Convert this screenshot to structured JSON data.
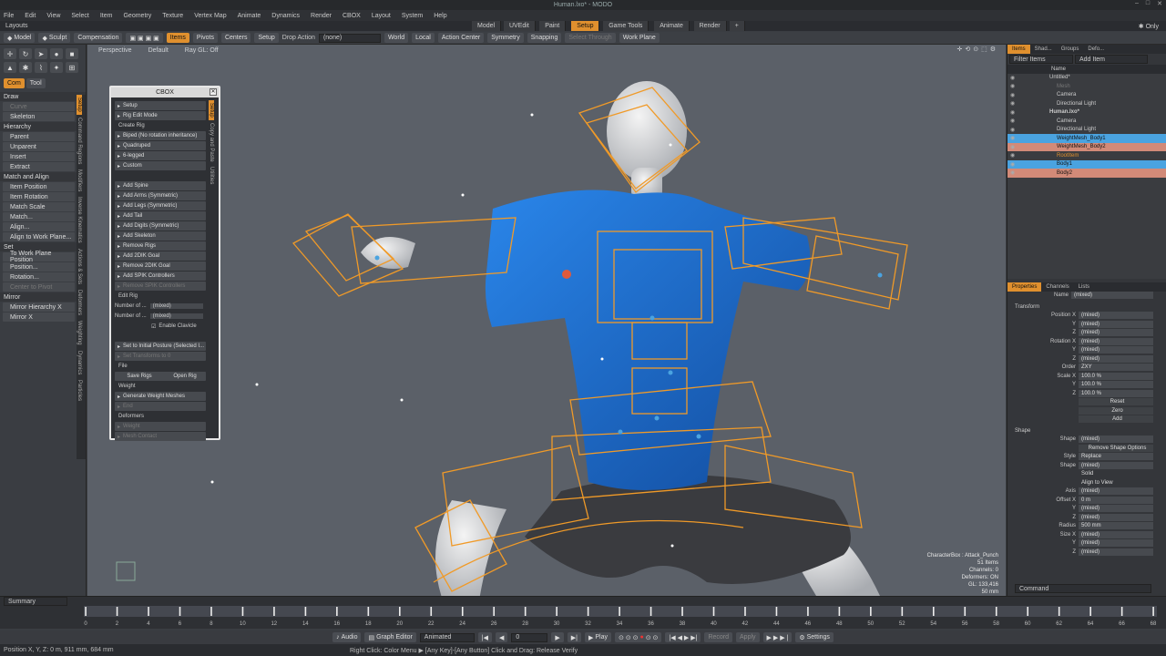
{
  "title": "Human.lxo* - MODO",
  "menu": [
    "File",
    "Edit",
    "View",
    "Select",
    "Item",
    "Geometry",
    "Texture",
    "Vertex Map",
    "Animate",
    "Dynamics",
    "Render",
    "CBOX",
    "Layout",
    "System",
    "Help"
  ],
  "layouts_label": "Layouts",
  "layout_tabs": [
    "Model",
    "UVEdit",
    "Paint",
    "Setup",
    "Game Tools",
    "Animate",
    "Render",
    "+"
  ],
  "layout_active": "Setup",
  "only_label": "Only",
  "toolbar": {
    "model": "Model",
    "sculpt": "Sculpt",
    "compensation": "Compensation",
    "items": "Items",
    "pivots": "Pivots",
    "centers": "Centers",
    "setup": "Setup",
    "drop_action_label": "Drop Action",
    "drop_action_value": "(none)",
    "world": "World",
    "local": "Local",
    "action_center": "Action Center",
    "symmetry": "Symmetry",
    "snapping": "Snapping",
    "select_through": "Select Through",
    "work_plane": "Work Plane"
  },
  "viewport": {
    "projection": "Perspective",
    "shading": "Default",
    "raygl": "Ray GL: Off",
    "info": [
      "CharacterBox : Attack_Punch",
      "51 Items",
      "Channels: 0",
      "Deformers: ON",
      "GL: 133,416",
      "50 mm"
    ]
  },
  "left": {
    "tabs": [
      "Com",
      "Tool"
    ],
    "items": [
      [
        "h",
        "Draw"
      ],
      [
        "d",
        "Curve"
      ],
      [
        "b",
        "Skeleton"
      ],
      [
        "h",
        "Hierarchy"
      ],
      [
        "b",
        "Parent"
      ],
      [
        "b",
        "Unparent"
      ],
      [
        "b",
        "Insert"
      ],
      [
        "b",
        "Extract"
      ],
      [
        "h",
        "Match and Align"
      ],
      [
        "b",
        "Item Position"
      ],
      [
        "b",
        "Item Rotation"
      ],
      [
        "b",
        "Match Scale"
      ],
      [
        "b",
        "Match..."
      ],
      [
        "b",
        "Align..."
      ],
      [
        "b",
        "Align to Work Plane..."
      ],
      [
        "h",
        "Set"
      ],
      [
        "b",
        "To Work Plane Position"
      ],
      [
        "b",
        "Position..."
      ],
      [
        "b",
        "Rotation..."
      ],
      [
        "d",
        "Center to Pivot"
      ],
      [
        "h",
        "Mirror"
      ],
      [
        "b",
        "Mirror Hierarchy X"
      ],
      [
        "b",
        "Mirror X"
      ]
    ],
    "vtabs": [
      "Setup",
      "Command Regions",
      "Modifiers",
      "Inverse Kinematics",
      "Actions & Sets",
      "Deformers",
      "Weighting",
      "Dynamics",
      "Particles"
    ]
  },
  "cbox": {
    "title": "CBOX",
    "rows": [
      [
        "b",
        "Setup"
      ],
      [
        "b",
        "Rig Edit Mode"
      ],
      [
        "s",
        "Create Rig"
      ],
      [
        "b",
        "Biped (No rotation inheritance)"
      ],
      [
        "b",
        "Quadruped"
      ],
      [
        "b",
        "6-legged"
      ],
      [
        "b",
        "Custom"
      ],
      [
        "s",
        ""
      ],
      [
        "b",
        "Add Spine"
      ],
      [
        "b",
        "Add Arms (Symmetric)"
      ],
      [
        "b",
        "Add Legs (Symmetric)"
      ],
      [
        "b",
        "Add Tail"
      ],
      [
        "b",
        "Add Digits (Symmetric)"
      ],
      [
        "b",
        "Add Skeleton"
      ],
      [
        "b",
        "Remove Rigs"
      ],
      [
        "b",
        "Add 2DIK Goal"
      ],
      [
        "b",
        "Remove 2DIK Goal"
      ],
      [
        "b",
        "Add SPIK Controllers"
      ],
      [
        "d",
        "Remove SPIK Controllers"
      ],
      [
        "s",
        "Edit Rig"
      ],
      [
        "f",
        "Number of ...",
        "(mixed)"
      ],
      [
        "f",
        "Number of ...",
        "(mixed)"
      ],
      [
        "c",
        "Enable Clavicle"
      ],
      [
        "s",
        ""
      ],
      [
        "b",
        "Set to Initial Posture (Selected I..."
      ],
      [
        "d",
        "Set Transforms to 0"
      ],
      [
        "s",
        "File"
      ],
      [
        "b2",
        "Save Rigs",
        "Open Rig"
      ],
      [
        "s",
        "Weight"
      ],
      [
        "b",
        "Generate Weight Meshes"
      ],
      [
        "d",
        "End"
      ],
      [
        "s",
        "Deformers"
      ],
      [
        "d",
        "Weight"
      ],
      [
        "d",
        "Mesh Contact"
      ]
    ],
    "vtabs": [
      "Setup",
      "Copy and Paste",
      "Utilities"
    ]
  },
  "items_panel": {
    "tabs": [
      "Items",
      "Shad...",
      "Groups",
      "Defo..."
    ],
    "filter": "Filter Items",
    "add_item": "Add Item",
    "name_col": "Name",
    "rows": [
      [
        "n",
        1,
        "Untitled*"
      ],
      [
        "d",
        2,
        "Mesh"
      ],
      [
        "n",
        2,
        "Camera"
      ],
      [
        "n",
        2,
        "Directional Light"
      ],
      [
        "b",
        1,
        "Human.lxo*"
      ],
      [
        "n",
        2,
        "Camera"
      ],
      [
        "n",
        2,
        "Directional Light"
      ],
      [
        "s",
        2,
        "WeightMesh_Body1"
      ],
      [
        "h",
        2,
        "WeightMesh_Body2"
      ],
      [
        "o",
        2,
        "RootItem"
      ],
      [
        "s",
        2,
        "Body1"
      ],
      [
        "h",
        2,
        "Body2"
      ]
    ]
  },
  "props": {
    "tabs": [
      "Properties",
      "Channels",
      "Lists"
    ],
    "name_label": "Name",
    "name_value": "(mixed)",
    "rows": [
      [
        "s",
        "Transform"
      ],
      [
        "p",
        "Position X",
        "(mixed)"
      ],
      [
        "p",
        "Y",
        "(mixed)"
      ],
      [
        "p",
        "Z",
        "(mixed)"
      ],
      [
        "p",
        "Rotation X",
        "(mixed)"
      ],
      [
        "p",
        "Y",
        "(mixed)"
      ],
      [
        "p",
        "Z",
        "(mixed)"
      ],
      [
        "p",
        "Order",
        "ZXY"
      ],
      [
        "p",
        "Scale X",
        "100.0 %"
      ],
      [
        "p",
        "Y",
        "100.0 %"
      ],
      [
        "p",
        "Z",
        "100.0 %"
      ],
      [
        "b",
        "",
        "Reset"
      ],
      [
        "b",
        "",
        "Zero"
      ],
      [
        "b",
        "",
        "Add"
      ],
      [
        "s",
        "Shape"
      ],
      [
        "p",
        "Shape",
        "(mixed)"
      ],
      [
        "b",
        "",
        "Remove Shape Options"
      ],
      [
        "p",
        "Style",
        "Replace"
      ],
      [
        "p",
        "Shape",
        "(mixed)"
      ],
      [
        "c",
        "",
        "Solid"
      ],
      [
        "c",
        "",
        "Align to View"
      ],
      [
        "p",
        "Axis",
        "(mixed)"
      ],
      [
        "p",
        "Offset X",
        "0 m"
      ],
      [
        "p",
        "Y",
        "(mixed)"
      ],
      [
        "p",
        "Z",
        "(mixed)"
      ],
      [
        "p",
        "Radius",
        "500 mm"
      ],
      [
        "p",
        "Size X",
        "(mixed)"
      ],
      [
        "p",
        "Y",
        "(mixed)"
      ],
      [
        "p",
        "Z",
        "(mixed)"
      ]
    ],
    "command_placeholder": "Command"
  },
  "timeline": {
    "summary": "Summary",
    "ticks": [
      "0",
      "2",
      "4",
      "6",
      "8",
      "10",
      "12",
      "14",
      "16",
      "18",
      "20",
      "22",
      "24",
      "26",
      "28",
      "30",
      "32",
      "34",
      "36",
      "38",
      "40",
      "42",
      "44",
      "46",
      "48",
      "50",
      "52",
      "54",
      "56",
      "58",
      "60",
      "62",
      "64",
      "66",
      "68"
    ]
  },
  "transport": {
    "audio": "Audio",
    "graph_editor": "Graph Editor",
    "animated": "Animated",
    "frame": "0",
    "play": "Play",
    "record": "Record",
    "apply": "Apply",
    "settings": "Settings"
  },
  "status": {
    "left": "Position X, Y, Z:  0 m, 911 mm, 684 mm",
    "center": "Right Click: Color Menu  ▶ [Any Key]-[Any Button] Click and Drag: Release Verify"
  },
  "colors": {
    "accent": "#e0902e",
    "select": "#4aa3e0",
    "shirt": "#1f6fd1",
    "rig": "#f09a28"
  }
}
